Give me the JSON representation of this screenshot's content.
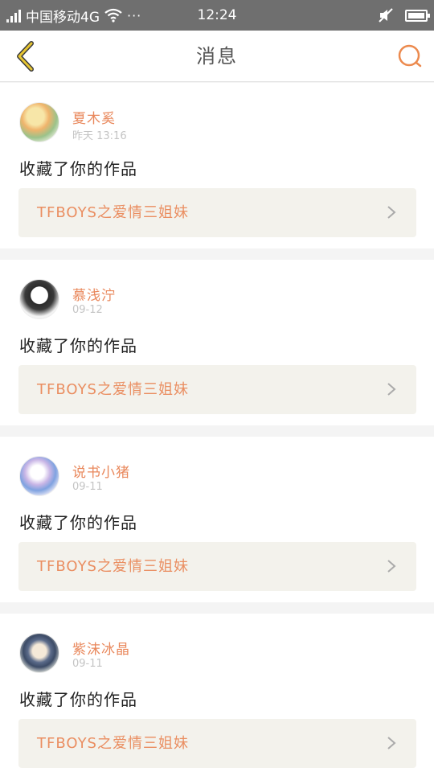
{
  "status_bar": {
    "carrier": "中国移动4G",
    "dots": "···",
    "time": "12:24"
  },
  "nav": {
    "title": "消息"
  },
  "messages": [
    {
      "user": "夏木奚",
      "time": "昨天 13:16",
      "action": "收藏了你的作品",
      "work": "TFBOYS之爱情三姐妹"
    },
    {
      "user": "慕浅泞",
      "time": "09-12",
      "action": "收藏了你的作品",
      "work": "TFBOYS之爱情三姐妹"
    },
    {
      "user": "说书小猪",
      "time": "09-11",
      "action": "收藏了你的作品",
      "work": "TFBOYS之爱情三姐妹"
    },
    {
      "user": "紫沫冰晶",
      "time": "09-11",
      "action": "收藏了你的作品",
      "work": "TFBOYS之爱情三姐妹"
    }
  ],
  "colors": {
    "accent": "#e9885c",
    "back_icon": "#e6a520",
    "link_bg": "#f3f2ec"
  },
  "icons": {
    "back": "chevron-left-icon",
    "search": "search-icon",
    "wifi": "wifi-icon",
    "signal": "signal-icon",
    "mute": "mute-icon",
    "battery": "battery-icon",
    "item_arrow": "chevron-right-icon"
  }
}
